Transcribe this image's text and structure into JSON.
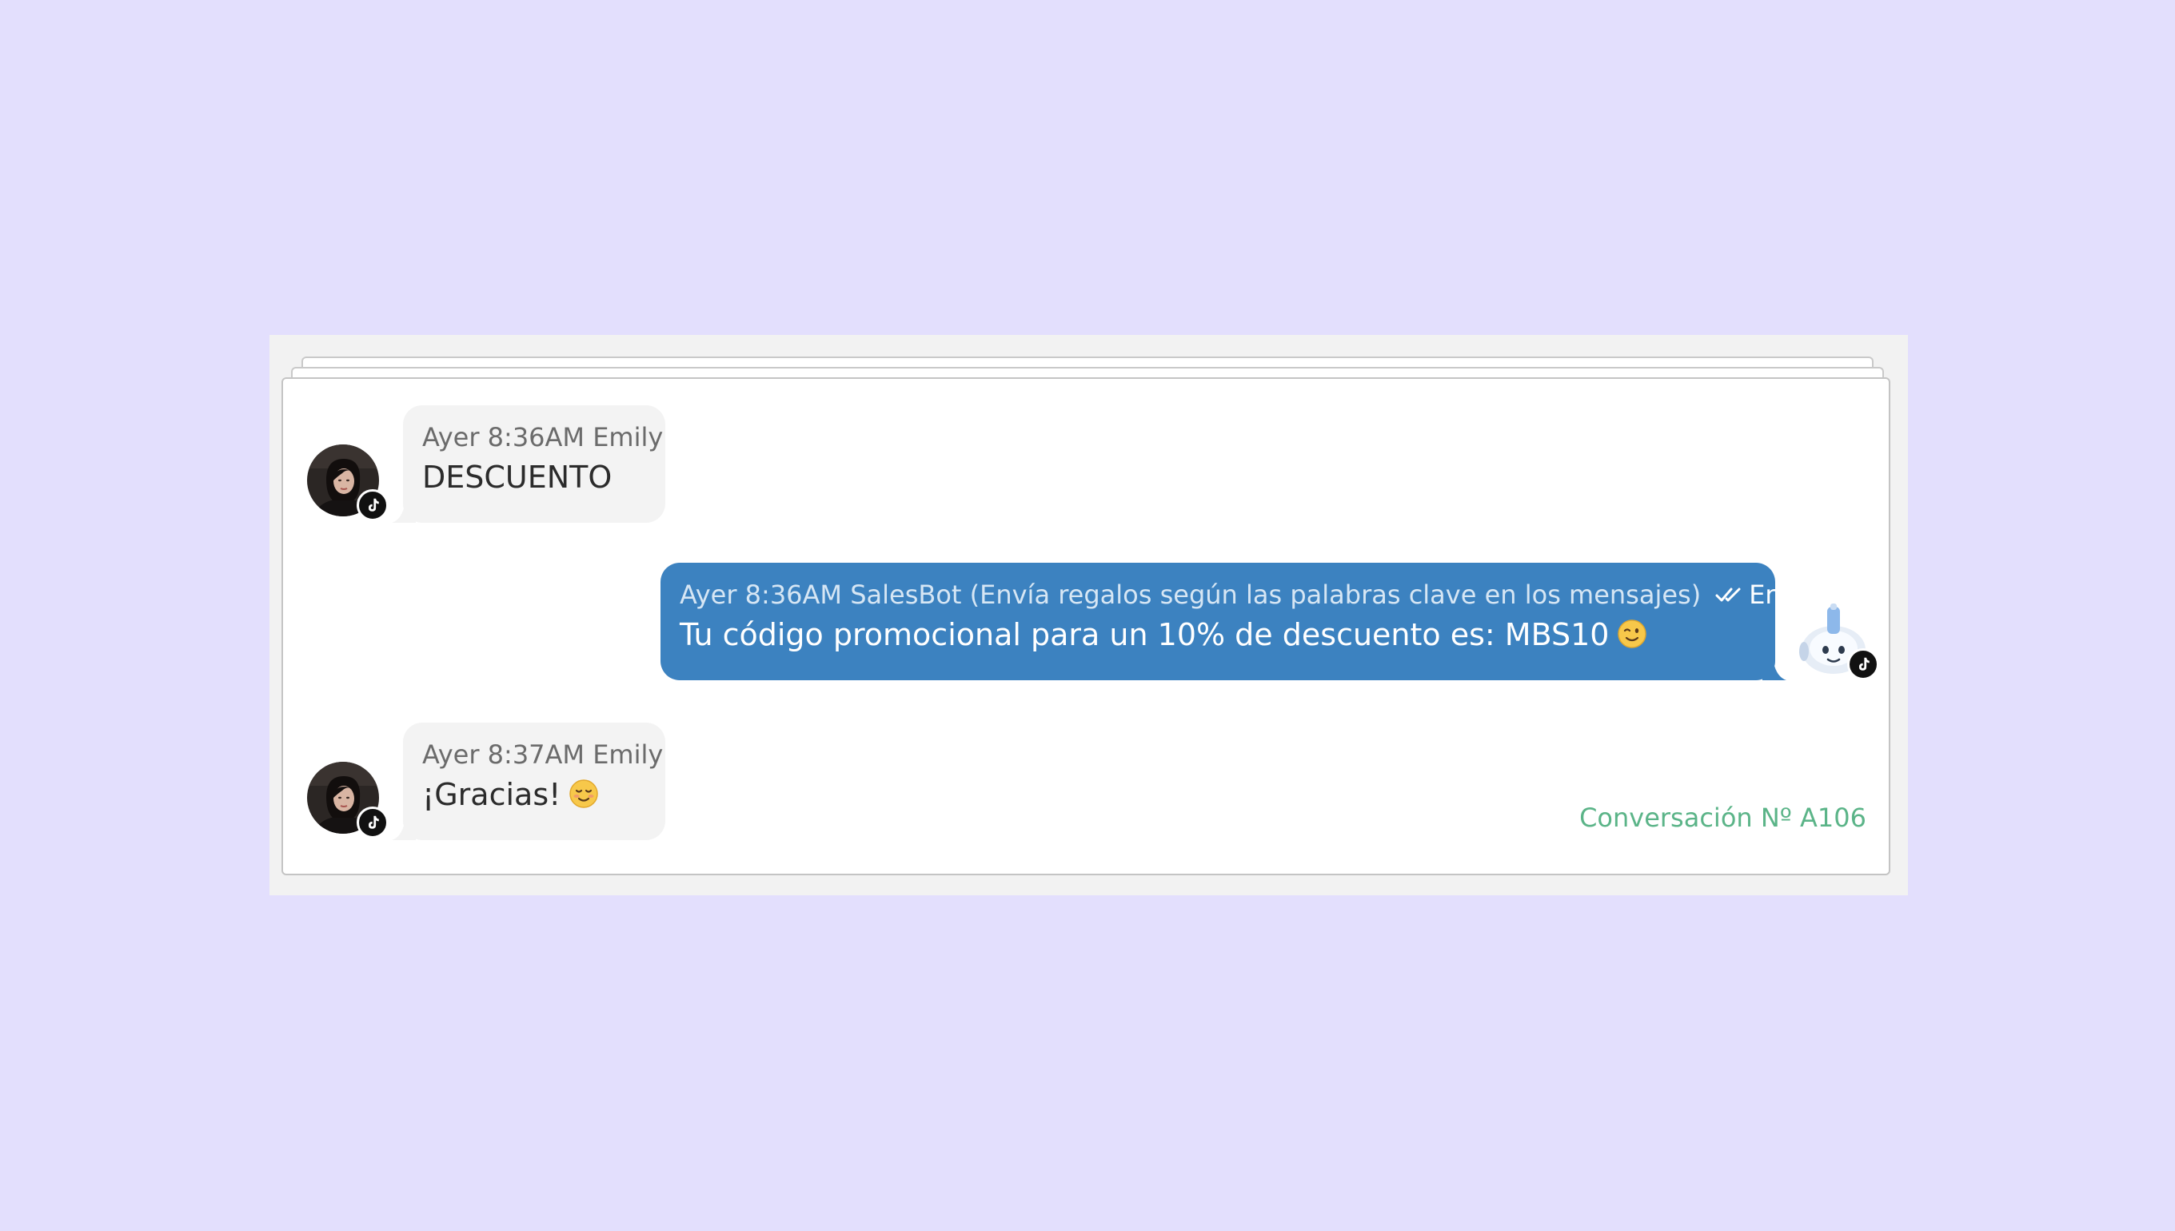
{
  "conversation": {
    "id_label": "Conversación Nº A106",
    "messages": [
      {
        "direction": "incoming",
        "meta": "Ayer 8:36AM Emily",
        "text": "DESCUENTO",
        "avatar": "user-photo",
        "channel_icon": "tiktok-icon"
      },
      {
        "direction": "outgoing",
        "meta": "Ayer 8:36AM SalesBot (Envía regalos según las palabras clave en los mensajes)",
        "status": "Entregado",
        "status_icon": "double-check-icon",
        "text": "Tu código promocional para un 10% de descuento es: MBS10",
        "emoji": "winking-face-emoji",
        "avatar": "robot-icon",
        "channel_icon": "tiktok-icon"
      },
      {
        "direction": "incoming",
        "meta": "Ayer 8:37AM Emily",
        "text": "¡Gracias!",
        "emoji": "smiling-face-emoji",
        "avatar": "user-photo",
        "channel_icon": "tiktok-icon"
      }
    ]
  },
  "colors": {
    "page_background": "#e3dffd",
    "outgoing_bubble": "#3c82c0",
    "incoming_bubble": "#f3f3f3",
    "conversation_id": "#5bb488"
  }
}
